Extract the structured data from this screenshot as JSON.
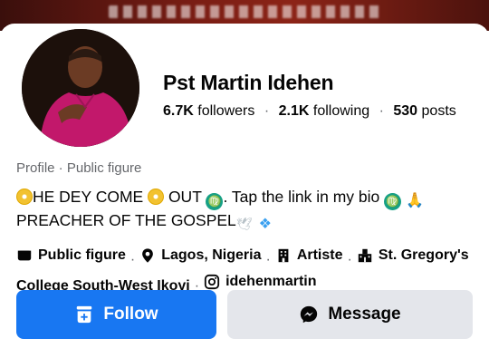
{
  "profile": {
    "name": "Pst Martin Idehen",
    "stats": {
      "followers_count": "6.7K",
      "followers_label": "followers",
      "following_count": "2.1K",
      "following_label": "following",
      "posts_count": "530",
      "posts_label": "posts"
    },
    "category_line": "Profile · Public figure",
    "bio": {
      "line1_a": "HE DEY COME",
      "line1_b": " OUT",
      "line1_c": ".  Tap the link in my bio",
      "line2": "PREACHER OF THE GOSPEL"
    },
    "details": [
      {
        "icon": "flag-icon",
        "text": "Public figure"
      },
      {
        "icon": "location-pin-icon",
        "text": "Lagos, Nigeria"
      },
      {
        "icon": "building-icon",
        "text": "Artiste"
      },
      {
        "icon": "school-icon",
        "text": "St. Gregory's"
      },
      {
        "text": "College South-West Ikoyi"
      },
      {
        "icon": "instagram-icon",
        "text": "idehenmartin"
      }
    ]
  },
  "actions": {
    "follow_label": "Follow",
    "message_label": "Message"
  },
  "colors": {
    "primary": "#1877f2",
    "secondary_bg": "#e4e6eb",
    "text": "#050505",
    "muted": "#65676b"
  }
}
